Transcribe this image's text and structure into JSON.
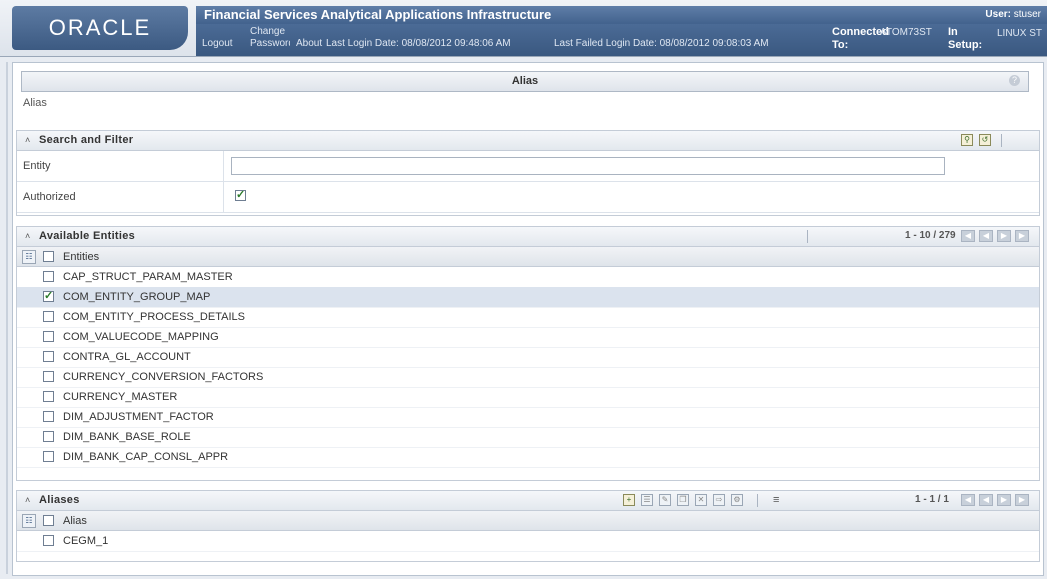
{
  "header": {
    "logo": "ORACLE",
    "app_title": "Financial Services Analytical Applications Infrastructure",
    "user_label": "User:",
    "user_value": "stuser",
    "logout": "Logout",
    "change_password": "Change Password",
    "about": "About",
    "last_login": "Last Login Date:  08/08/2012 09:48:06 AM",
    "last_failed_login": "Last Failed Login Date:  08/08/2012 09:08:03 AM",
    "connected_label": "Connected To:",
    "connected_value": "ATOM73ST",
    "in_setup_label": "In Setup:",
    "in_setup_value": "LINUX ST"
  },
  "page": {
    "title": "Alias",
    "breadcrumb": "Alias",
    "help_icon": "help-icon"
  },
  "search": {
    "section_title": "Search and Filter",
    "entity_label": "Entity",
    "entity_value": "",
    "authorized_label": "Authorized",
    "authorized_checked": true
  },
  "entities": {
    "section_title": "Available Entities",
    "pagination": "1 - 10 / 279",
    "column": "Entities",
    "rows": [
      {
        "name": "CAP_STRUCT_PARAM_MASTER",
        "checked": false
      },
      {
        "name": "COM_ENTITY_GROUP_MAP",
        "checked": true
      },
      {
        "name": "COM_ENTITY_PROCESS_DETAILS",
        "checked": false
      },
      {
        "name": "COM_VALUECODE_MAPPING",
        "checked": false
      },
      {
        "name": "CONTRA_GL_ACCOUNT",
        "checked": false
      },
      {
        "name": "CURRENCY_CONVERSION_FACTORS",
        "checked": false
      },
      {
        "name": "CURRENCY_MASTER",
        "checked": false
      },
      {
        "name": "DIM_ADJUSTMENT_FACTOR",
        "checked": false
      },
      {
        "name": "DIM_BANK_BASE_ROLE",
        "checked": false
      },
      {
        "name": "DIM_BANK_CAP_CONSL_APPR",
        "checked": false
      }
    ]
  },
  "aliases": {
    "section_title": "Aliases",
    "pagination": "1 - 1 / 1",
    "column": "Alias",
    "rows": [
      {
        "name": "CEGM_1",
        "checked": false
      }
    ]
  },
  "colors": {
    "header_blue": "#42628d",
    "selected_row": "#dbe3ee",
    "check_green": "#2b7a2b"
  }
}
